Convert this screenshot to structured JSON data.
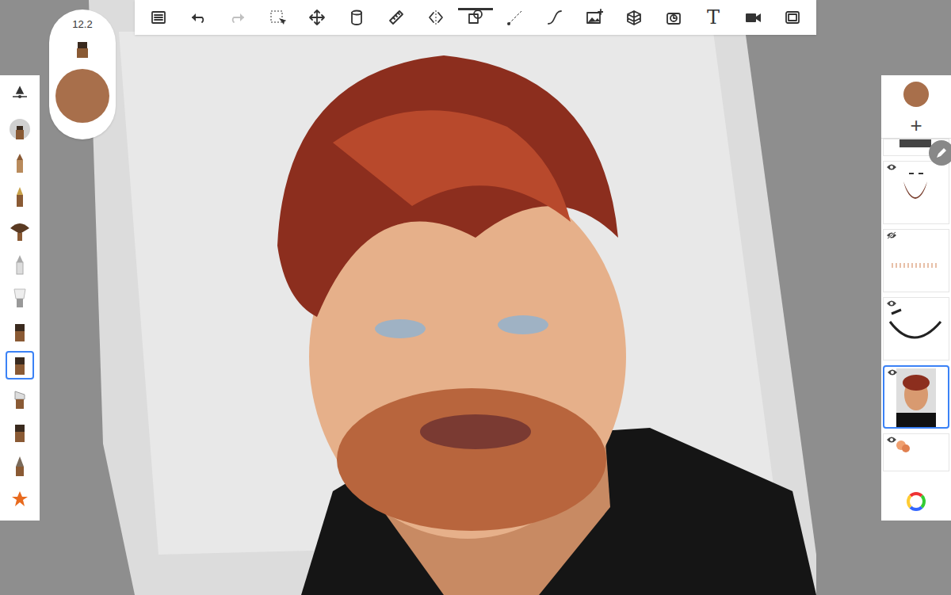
{
  "brush_puck": {
    "size": "12.2",
    "color": "#a86f4b"
  },
  "toolbar": [
    {
      "name": "layer-list",
      "label": "",
      "selected": false,
      "disabled": false
    },
    {
      "name": "undo",
      "label": "",
      "selected": false,
      "disabled": false
    },
    {
      "name": "redo",
      "label": "",
      "selected": false,
      "disabled": true
    },
    {
      "name": "selection",
      "label": "",
      "selected": false,
      "disabled": false
    },
    {
      "name": "transform",
      "label": "",
      "selected": false,
      "disabled": false
    },
    {
      "name": "fill",
      "label": "",
      "selected": false,
      "disabled": false
    },
    {
      "name": "ruler",
      "label": "",
      "selected": false,
      "disabled": false
    },
    {
      "name": "symmetry",
      "label": "",
      "selected": false,
      "disabled": false
    },
    {
      "name": "shapes",
      "label": "",
      "selected": true,
      "disabled": false
    },
    {
      "name": "line",
      "label": "",
      "selected": false,
      "disabled": false
    },
    {
      "name": "stroke",
      "label": "",
      "selected": false,
      "disabled": false
    },
    {
      "name": "add-image",
      "label": "",
      "selected": false,
      "disabled": false
    },
    {
      "name": "perspective",
      "label": "",
      "selected": false,
      "disabled": false
    },
    {
      "name": "timelapse",
      "label": "",
      "selected": false,
      "disabled": false
    },
    {
      "name": "text",
      "label": "T",
      "selected": false,
      "disabled": false
    },
    {
      "name": "video",
      "label": "",
      "selected": false,
      "disabled": false
    },
    {
      "name": "fullscreen",
      "label": "",
      "selected": false,
      "disabled": false
    }
  ],
  "brushes": [
    {
      "kind": "slider",
      "selected": false
    },
    {
      "kind": "round",
      "selected": false
    },
    {
      "kind": "pencil",
      "selected": false
    },
    {
      "kind": "pen",
      "selected": false
    },
    {
      "kind": "fan",
      "selected": false
    },
    {
      "kind": "marker",
      "selected": false
    },
    {
      "kind": "shaving",
      "selected": false
    },
    {
      "kind": "flat",
      "selected": false
    },
    {
      "kind": "flat",
      "selected": true
    },
    {
      "kind": "angled",
      "selected": false
    },
    {
      "kind": "flat",
      "selected": false
    },
    {
      "kind": "tip",
      "selected": false
    },
    {
      "kind": "star",
      "selected": false
    }
  ],
  "layers_panel": {
    "color": "#a86f4b",
    "add_label": "+",
    "layers": [
      {
        "kind": "partial",
        "visible": true,
        "selected": false
      },
      {
        "kind": "beard",
        "visible": true,
        "selected": false
      },
      {
        "kind": "specks",
        "visible": false,
        "selected": false
      },
      {
        "kind": "brows",
        "visible": true,
        "selected": false
      },
      {
        "kind": "portrait",
        "visible": true,
        "selected": true
      },
      {
        "kind": "swatch",
        "visible": true,
        "selected": false
      }
    ]
  }
}
